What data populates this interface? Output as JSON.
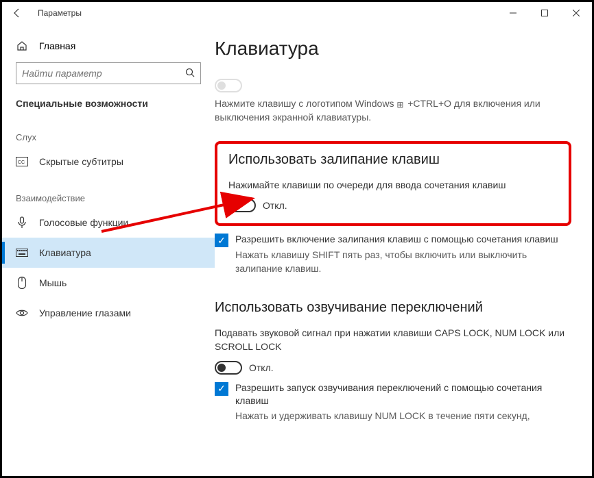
{
  "window": {
    "title": "Параметры"
  },
  "sidebar": {
    "home_label": "Главная",
    "search_placeholder": "Найти параметр",
    "category_title": "Специальные возможности",
    "section_hearing": "Слух",
    "section_interaction": "Взаимодействие",
    "items": {
      "subtitles": "Скрытые субтитры",
      "voice": "Голосовые функции",
      "keyboard": "Клавиатура",
      "mouse": "Мышь",
      "eye": "Управление глазами"
    }
  },
  "main": {
    "page_title": "Клавиатура",
    "osk_hint": "Нажмите клавишу с логотипом Windows",
    "osk_hint2": "+CTRL+O для включения или выключения экранной клавиатуры.",
    "sticky": {
      "heading": "Использовать залипание клавиш",
      "desc": "Нажимайте клавиши по очереди для ввода сочетания клавиш",
      "state": "Откл.",
      "cb_label": "Разрешить включение залипания клавиш с помощью сочетания клавиш",
      "cb_hint": "Нажать клавишу SHIFT пять раз, чтобы включить или выключить залипание клавиш."
    },
    "toggle_keys": {
      "heading": "Использовать озвучивание переключений",
      "desc": "Подавать звуковой сигнал при нажатии клавиши CAPS LOCK, NUM LOCK или SCROLL LOCK",
      "state": "Откл.",
      "cb_label": "Разрешить запуск озвучивания переключений с помощью сочетания клавиш",
      "cb_hint": "Нажать и удерживать клавишу NUM LOCK в течение пяти секунд,"
    }
  }
}
